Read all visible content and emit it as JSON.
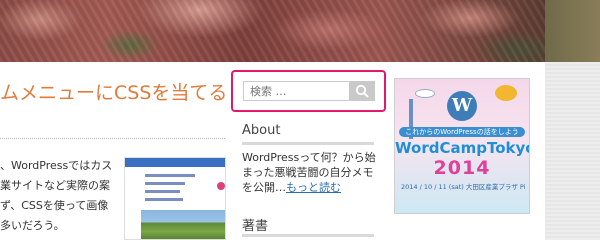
{
  "post": {
    "title": "ムメニューにCSSを当てる",
    "excerpt_lines": [
      "、WordPressではカス",
      "業サイトなど実際の案",
      "ず、CSSを使って画像",
      "多いだろう。"
    ]
  },
  "search": {
    "placeholder": "検索 …",
    "icon": "search-icon"
  },
  "about": {
    "title": "About",
    "lines": [
      "WordPressって何？から始",
      "まった悪戦苦闘の自分メモ",
      "を公開…"
    ],
    "more_link": "もっと読む"
  },
  "books": {
    "title": "著書"
  },
  "banner": {
    "ribbon": "これからのWordPressの話をしよう",
    "name": "WordCampTokyo",
    "year": "2014",
    "date": "2014 / 10 / 11 (sat)  大田区産業プラザ PiO"
  },
  "colors": {
    "accent": "#e0196b",
    "title": "#e07b3c",
    "link": "#2c6fb0"
  }
}
